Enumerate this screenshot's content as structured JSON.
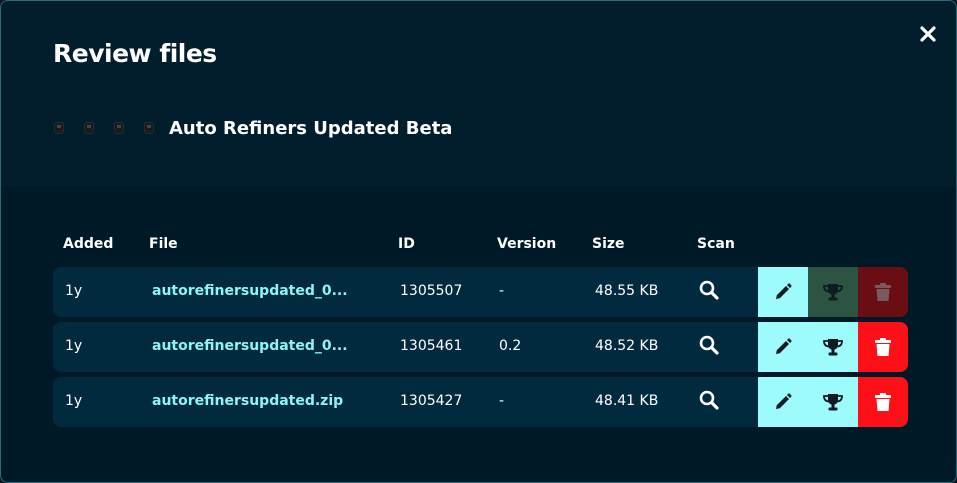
{
  "dialog": {
    "title": "Review files",
    "close_icon": "close-icon"
  },
  "project": {
    "name": "Auto Refiners Updated Beta",
    "thumbnail_icon": "block-thumbnail-icon"
  },
  "table": {
    "headers": {
      "added": "Added",
      "file": "File",
      "id": "ID",
      "version": "Version",
      "size": "Size",
      "scan": "Scan"
    },
    "rows": [
      {
        "added": "1y",
        "file": "autorefinersupdated_0...",
        "id": "1305507",
        "version": "-",
        "size": "48.55 KB",
        "trophy_enabled": false,
        "delete_enabled": false
      },
      {
        "added": "1y",
        "file": "autorefinersupdated_0...",
        "id": "1305461",
        "version": "0.2",
        "size": "48.52 KB",
        "trophy_enabled": true,
        "delete_enabled": true
      },
      {
        "added": "1y",
        "file": "autorefinersupdated.zip",
        "id": "1305427",
        "version": "-",
        "size": "48.41 KB",
        "trophy_enabled": true,
        "delete_enabled": true
      }
    ]
  },
  "colors": {
    "background": "#011c2b",
    "row": "#022a3e",
    "accent_cyan": "#9dfbfb",
    "link": "#8ef4f4",
    "danger": "#ff1018",
    "trophy_disabled": "#2d5442",
    "danger_disabled": "#6a0e14"
  }
}
